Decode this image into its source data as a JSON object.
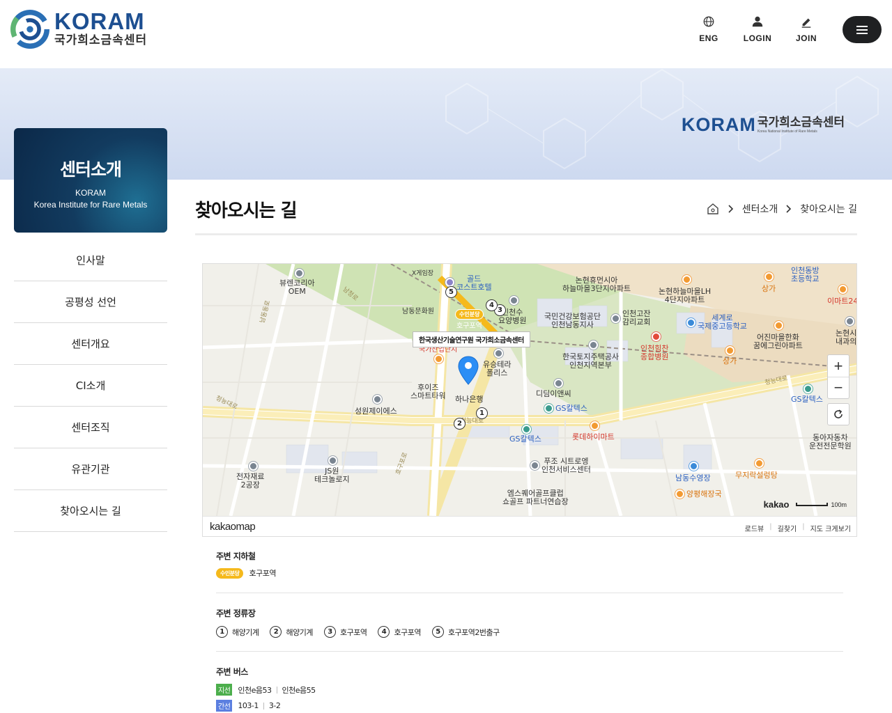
{
  "header": {
    "logo_en": "KORAM",
    "logo_ko": "국가희소금속센터",
    "util": [
      {
        "label": "ENG",
        "icon": "globe-icon"
      },
      {
        "label": "LOGIN",
        "icon": "user-icon"
      },
      {
        "label": "JOIN",
        "icon": "pencil-icon"
      }
    ],
    "menu_icon": "hamburger-icon"
  },
  "banner": {
    "logo_en": "KORAM",
    "logo_ko": "국가희소금속센터",
    "logo_sub": "Korea National Institute of Rare Metals"
  },
  "side": {
    "title": "센터소개",
    "sub1": "KORAM",
    "sub2": "Korea Institute for Rare Metals",
    "menu": [
      "인사말",
      "공평성 선언",
      "센터개요",
      "CI소개",
      "센터조직",
      "유관기관",
      "찾아오시는 길"
    ]
  },
  "page": {
    "title": "찾아오시는 길",
    "breadcrumb": [
      "센터소개",
      "찾아오시는 길"
    ]
  },
  "map": {
    "info_window": "한국생산기술연구원 국가희소금속센터",
    "brand": "kakaomap",
    "links": [
      "로드뷰",
      "길찾기",
      "지도 크게보기"
    ],
    "zoom_in": "+",
    "zoom_out": "−",
    "scale_logo": "kakao",
    "scale_text": "100m",
    "subway_badge": "수인분당",
    "labels": [
      {
        "t": "뷰렌코리아\nOEM"
      },
      {
        "t": "X게임장"
      },
      {
        "t": "골드\n코스트호텔"
      },
      {
        "t": "남동문화원"
      },
      {
        "t": "인천수\n요양병원"
      },
      {
        "t": "국민건강보험공단\n인천남동지사"
      },
      {
        "t": "논현휴먼시아\n하늘마을3단지아파트"
      },
      {
        "t": "논현하늘마을LH\n4단지아파트"
      },
      {
        "t": "인천동방\n초등학교"
      },
      {
        "t": "상가"
      },
      {
        "t": "이마트24"
      },
      {
        "t": "인천고잔\n감리교회"
      },
      {
        "t": "세계로\n국제중고등학교"
      },
      {
        "t": "어진마을한화\n꿈에그린아파트"
      },
      {
        "t": "논현시\n내과의"
      },
      {
        "t": "인천힘찬\n종합병원"
      },
      {
        "t": "상가"
      },
      {
        "t": "한국토지주택공사\n인천지역본부"
      },
      {
        "t": "유승테라\n폴리스"
      },
      {
        "t": "후이즈\n스마트타워"
      },
      {
        "t": "하나은행"
      },
      {
        "t": "디딤이앤씨"
      },
      {
        "t": "GS칼텍스"
      },
      {
        "t": "GS칼텍스"
      },
      {
        "t": "성원제이에스"
      },
      {
        "t": "GS칼텍스"
      },
      {
        "t": "롯데하이마트"
      },
      {
        "t": "동아자동차\n운전전문학원"
      },
      {
        "t": "전자재료\n2공장"
      },
      {
        "t": "JS원\n테크놀로지"
      },
      {
        "t": "푸조 시트로엥\n인천서비스센터"
      },
      {
        "t": "엠스퀘어골프클럽\n쇼골프 파트너연습장"
      },
      {
        "t": "남동수영장"
      },
      {
        "t": "무지락설렁탕"
      },
      {
        "t": "양평해장국"
      },
      {
        "t": "호구포역"
      },
      {
        "t": "국가산업단지"
      }
    ],
    "roads": [
      "남동동로",
      "청능대로",
      "남청로",
      "청능대로",
      "호구포로",
      "청능대로"
    ],
    "stops": [
      "1",
      "2",
      "3",
      "4",
      "5"
    ]
  },
  "info": {
    "subway": {
      "head": "주변 지하철",
      "badge": "수인분당",
      "station": "호구포역"
    },
    "stops": {
      "head": "주변 정류장",
      "items": [
        {
          "n": "1",
          "name": "해양기계"
        },
        {
          "n": "2",
          "name": "해양기계"
        },
        {
          "n": "3",
          "name": "호구포역"
        },
        {
          "n": "4",
          "name": "호구포역"
        },
        {
          "n": "5",
          "name": "호구포역2번출구"
        }
      ]
    },
    "bus": {
      "head": "주변 버스",
      "rows": [
        {
          "badge": "지선",
          "color": "green",
          "routes": [
            "인천e음53",
            "인천e음55"
          ]
        },
        {
          "badge": "간선",
          "color": "blue",
          "routes": [
            "103-1",
            "3-2"
          ]
        }
      ]
    }
  },
  "colors": {
    "accent": "#1d4f91",
    "subway": "#f5b91c",
    "side_box": "#123b5f"
  }
}
